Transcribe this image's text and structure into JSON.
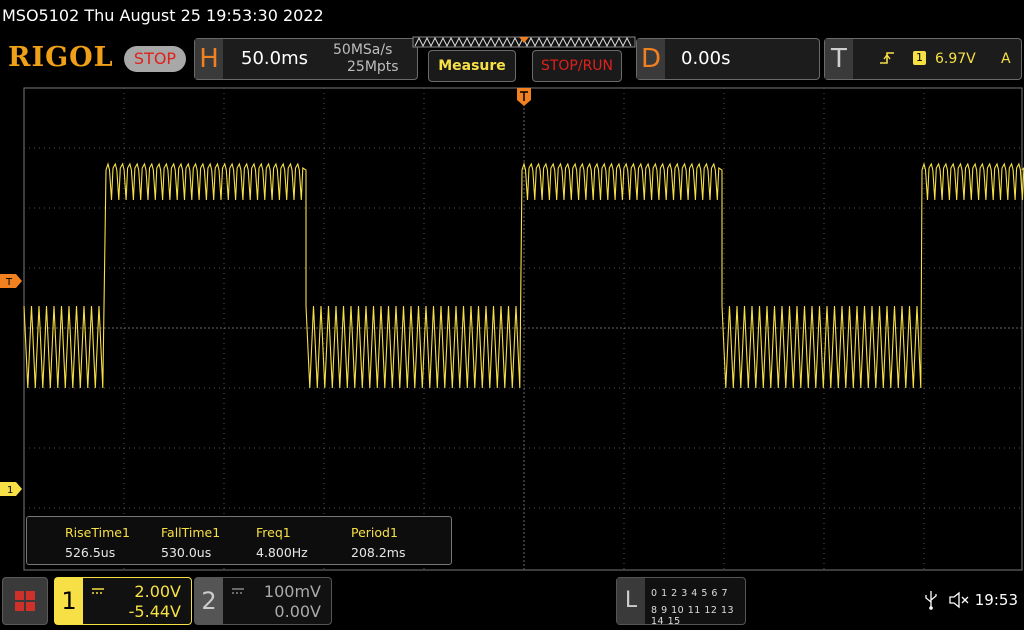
{
  "title": "MSO5102  Thu August 25 19:53:30 2022",
  "logo": "RIGOL",
  "run_state": "STOP",
  "horizontal": {
    "letter": "H",
    "timebase": "50.0ms",
    "sample_rate": "50MSa/s",
    "memory_depth": "25Mpts"
  },
  "buttons": {
    "measure": "Measure",
    "stop_run": "STOP/RUN"
  },
  "delay": {
    "letter": "D",
    "value": "0.00s"
  },
  "trigger": {
    "letter": "T",
    "source": "1",
    "level": "6.97V",
    "mode": "A"
  },
  "markers": {
    "trigger_level": "T",
    "ch1_ground": "1"
  },
  "measurements": [
    {
      "name": "RiseTime1",
      "value": "526.5us"
    },
    {
      "name": "FallTime1",
      "value": "530.0us"
    },
    {
      "name": "Freq1",
      "value": "4.800Hz"
    },
    {
      "name": "Period1",
      "value": "208.2ms"
    }
  ],
  "channel1": {
    "number": "1",
    "scale": "2.00V",
    "offset": "-5.44V",
    "color": "#f7e046"
  },
  "channel2": {
    "number": "2",
    "scale": "100mV",
    "offset": "0.00V"
  },
  "logic": {
    "letter": "L",
    "row1": "0 1 2 3  4 5 6 7",
    "row2": "8 9 10 11 12 13 14 15"
  },
  "status": {
    "time": "19:53"
  },
  "icons": [
    "menu-icon",
    "usb-icon",
    "speaker-muted-icon",
    "trigger-edge-icon"
  ]
}
